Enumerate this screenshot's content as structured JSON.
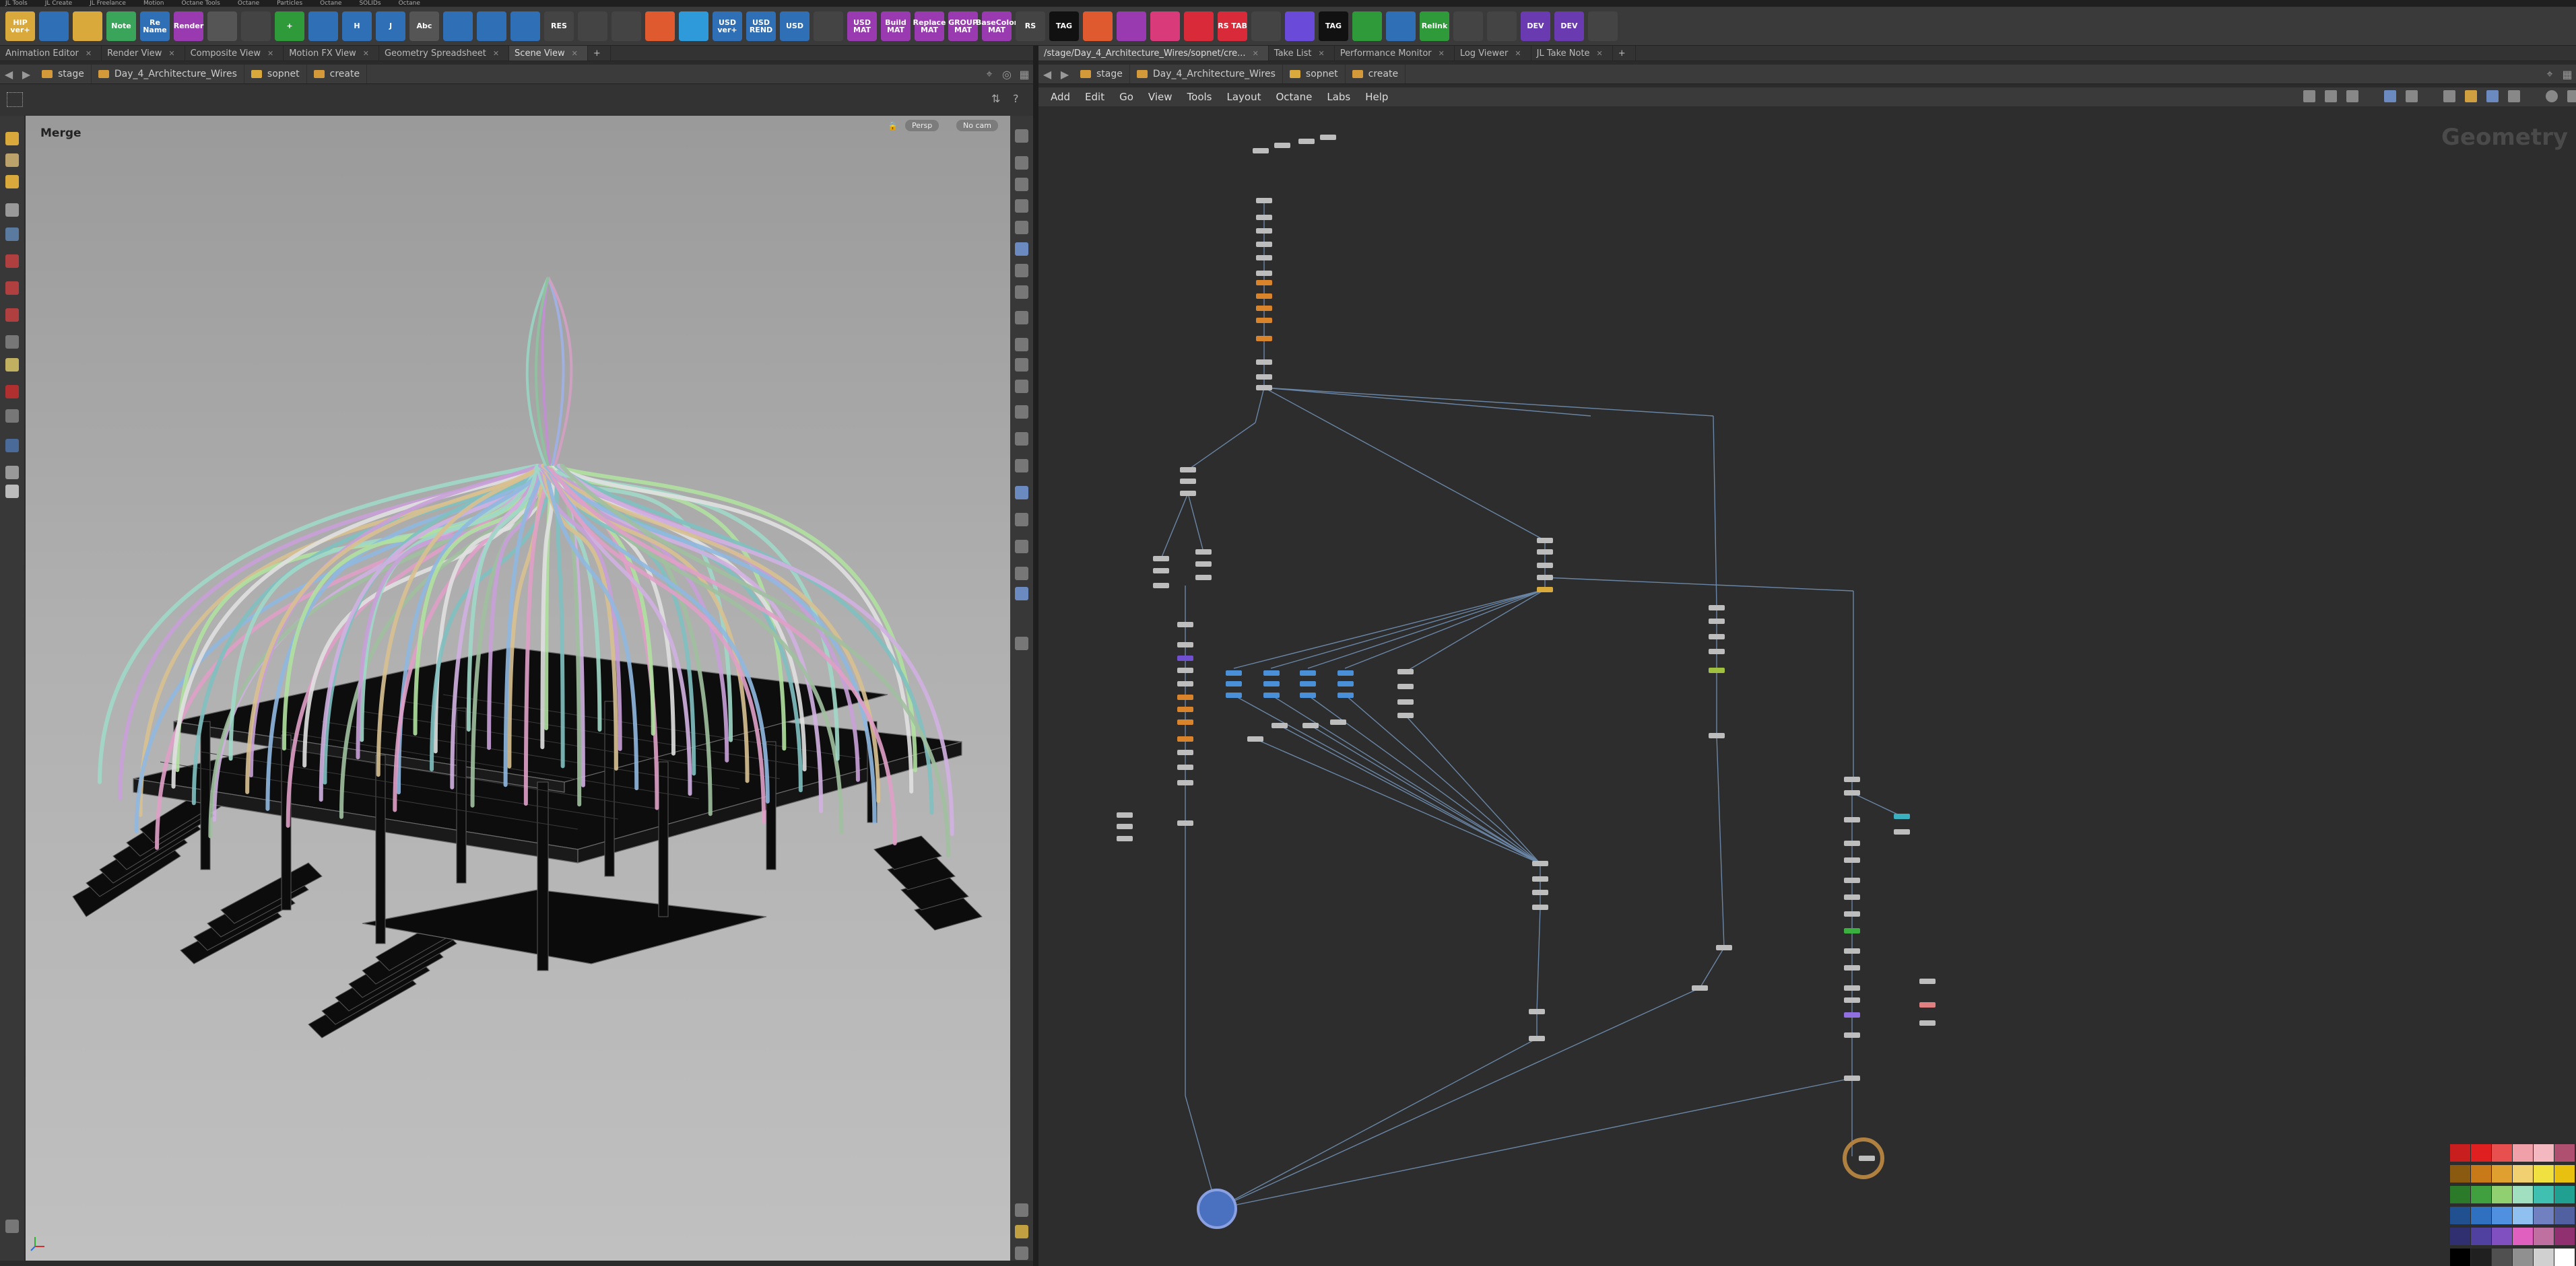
{
  "menu_strip": [
    "JL Tools",
    "JL Create",
    "JL Freelance",
    "Motion",
    "Octane Tools",
    "Octane",
    "Particles",
    "Octane",
    "SOLIDs",
    "Octane"
  ],
  "shelf": {
    "tools": [
      {
        "name": "hip-version-tool",
        "label": "HIP ver+",
        "color": "#d9a93b"
      },
      {
        "name": "list-tool",
        "label": "",
        "color": "#2f6fb5"
      },
      {
        "name": "runner-tool",
        "label": "",
        "color": "#d9a93b"
      },
      {
        "name": "note-tool",
        "label": "Note",
        "color": "#3aa55a"
      },
      {
        "name": "rename-tool",
        "label": "Re Name",
        "color": "#2f6fb5"
      },
      {
        "name": "render-tool",
        "label": "Render",
        "color": "#9a3ab0"
      },
      {
        "name": "grid-tool",
        "label": "",
        "color": "#555"
      },
      {
        "name": "pointer-tool",
        "label": "",
        "color": "#444"
      },
      {
        "name": "add-tool",
        "label": "+",
        "color": "#2f9a3a"
      },
      {
        "name": "box-tool",
        "label": "",
        "color": "#2f6fb5"
      },
      {
        "name": "h-tool",
        "label": "H",
        "color": "#2f6fb5"
      },
      {
        "name": "j-tool",
        "label": "J",
        "color": "#2f6fb5"
      },
      {
        "name": "alembic-tool",
        "label": "Abc",
        "color": "#555"
      },
      {
        "name": "lines-tool",
        "label": "",
        "color": "#2f6fb5"
      },
      {
        "name": "camera-tool",
        "label": "",
        "color": "#2f6fb5"
      },
      {
        "name": "play-tool",
        "label": "",
        "color": "#2f6fb5"
      },
      {
        "name": "res-tool",
        "label": "RES",
        "color": "#444"
      },
      {
        "name": "grid2-tool",
        "label": "",
        "color": "#444"
      },
      {
        "name": "speaker-tool",
        "label": "",
        "color": "#444"
      },
      {
        "name": "octane-a-tool",
        "label": "",
        "color": "#e05a2f"
      },
      {
        "name": "octane-b-tool",
        "label": "",
        "color": "#2f9ad9"
      },
      {
        "name": "usd-ver-tool",
        "label": "USD ver+",
        "color": "#2f6fb5"
      },
      {
        "name": "usd-rend-tool",
        "label": "USD REND",
        "color": "#2f6fb5"
      },
      {
        "name": "usd-ref-tool",
        "label": "USD",
        "color": "#2f6fb5"
      },
      {
        "name": "stage-tool",
        "label": "",
        "color": "#444"
      },
      {
        "name": "usd-mat-tool",
        "label": "USD MAT",
        "color": "#9a3ab0"
      },
      {
        "name": "build-mat-tool",
        "label": "Build MAT",
        "color": "#9a3ab0"
      },
      {
        "name": "replace-mat-tool",
        "label": "Replace MAT",
        "color": "#9a3ab0"
      },
      {
        "name": "group-mat-tool",
        "label": "GROUP MAT",
        "color": "#9a3ab0"
      },
      {
        "name": "basecolor-mat-tool",
        "label": "BaseColor MAT",
        "color": "#9a3ab0"
      },
      {
        "name": "rs-tool",
        "label": "RS",
        "color": "#444"
      },
      {
        "name": "tag-tool",
        "label": "TAG",
        "color": "#111"
      },
      {
        "name": "octane-c-tool",
        "label": "",
        "color": "#e05a2f"
      },
      {
        "name": "purple-tool",
        "label": "",
        "color": "#9a3ab0"
      },
      {
        "name": "pink-tool",
        "label": "",
        "color": "#d93a7a"
      },
      {
        "name": "red-tool",
        "label": "",
        "color": "#d92a3a"
      },
      {
        "name": "rs-tab-tool",
        "label": "RS TAB",
        "color": "#d92a3a"
      },
      {
        "name": "grid3-tool",
        "label": "",
        "color": "#444"
      },
      {
        "name": "cube-tool",
        "label": "",
        "color": "#6a4ad9"
      },
      {
        "name": "tag2-tool",
        "label": "TAG",
        "color": "#111"
      },
      {
        "name": "checker-tool",
        "label": "",
        "color": "#2f9a3a"
      },
      {
        "name": "inspect-tool",
        "label": "",
        "color": "#2f6fb5"
      },
      {
        "name": "relink-tool",
        "label": "Relink",
        "color": "#2f9a3a"
      },
      {
        "name": "bars-tool",
        "label": "",
        "color": "#444"
      },
      {
        "name": "tri-tool",
        "label": "",
        "color": "#444"
      },
      {
        "name": "dev-a-tool",
        "label": "DEV",
        "color": "#6a3ab0"
      },
      {
        "name": "dev-b-tool",
        "label": "DEV",
        "color": "#6a3ab0"
      },
      {
        "name": "box3d-tool",
        "label": "",
        "color": "#444"
      }
    ]
  },
  "left_pane": {
    "tabs": [
      {
        "label": "Animation Editor",
        "active": false
      },
      {
        "label": "Render View",
        "active": false
      },
      {
        "label": "Composite View",
        "active": false
      },
      {
        "label": "Motion FX View",
        "active": false
      },
      {
        "label": "Geometry Spreadsheet",
        "active": false
      },
      {
        "label": "Scene View",
        "active": true
      }
    ],
    "add_tab_label": "+",
    "path": [
      {
        "label": "stage"
      },
      {
        "label": "Day_4_Architecture_Wires"
      },
      {
        "label": "sopnet"
      },
      {
        "label": "create"
      }
    ],
    "viewport": {
      "title": "Merge",
      "persp_label": "Persp",
      "camera_label": "No cam"
    }
  },
  "right_pane": {
    "tabs": [
      {
        "label": "/stage/Day_4_Architecture_Wires/sopnet/cre...",
        "active": true
      },
      {
        "label": "Take List",
        "active": false
      },
      {
        "label": "Performance Monitor",
        "active": false
      },
      {
        "label": "Log Viewer",
        "active": false
      },
      {
        "label": "JL Take Note",
        "active": false
      }
    ],
    "add_tab_label": "+",
    "path": [
      {
        "label": "stage"
      },
      {
        "label": "Day_4_Architecture_Wires"
      },
      {
        "label": "sopnet"
      },
      {
        "label": "create"
      }
    ],
    "menu": [
      "Add",
      "Edit",
      "Go",
      "View",
      "Tools",
      "Layout",
      "Octane",
      "Labs",
      "Help"
    ],
    "context_label": "Geometry",
    "palette": [
      "#c81e1e",
      "#e02020",
      "#e85050",
      "#f0a0a8",
      "#f4b8c0",
      "#b05070",
      "#8a5a10",
      "#c87a18",
      "#e0a030",
      "#f0d070",
      "#f0e040",
      "#e8c010",
      "#2a7a2a",
      "#40a040",
      "#90d070",
      "#a0e0c0",
      "#40c0b0",
      "#20a090",
      "#205090",
      "#3070c0",
      "#5090e0",
      "#90c0f0",
      "#7080c0",
      "#5060a0",
      "#303070",
      "#5040a0",
      "#8050c0",
      "#e060c0",
      "#c070a0",
      "#903070",
      "#000000",
      "#202020",
      "#505050",
      "#909090",
      "#d0d0d0",
      "#ffffff"
    ]
  }
}
